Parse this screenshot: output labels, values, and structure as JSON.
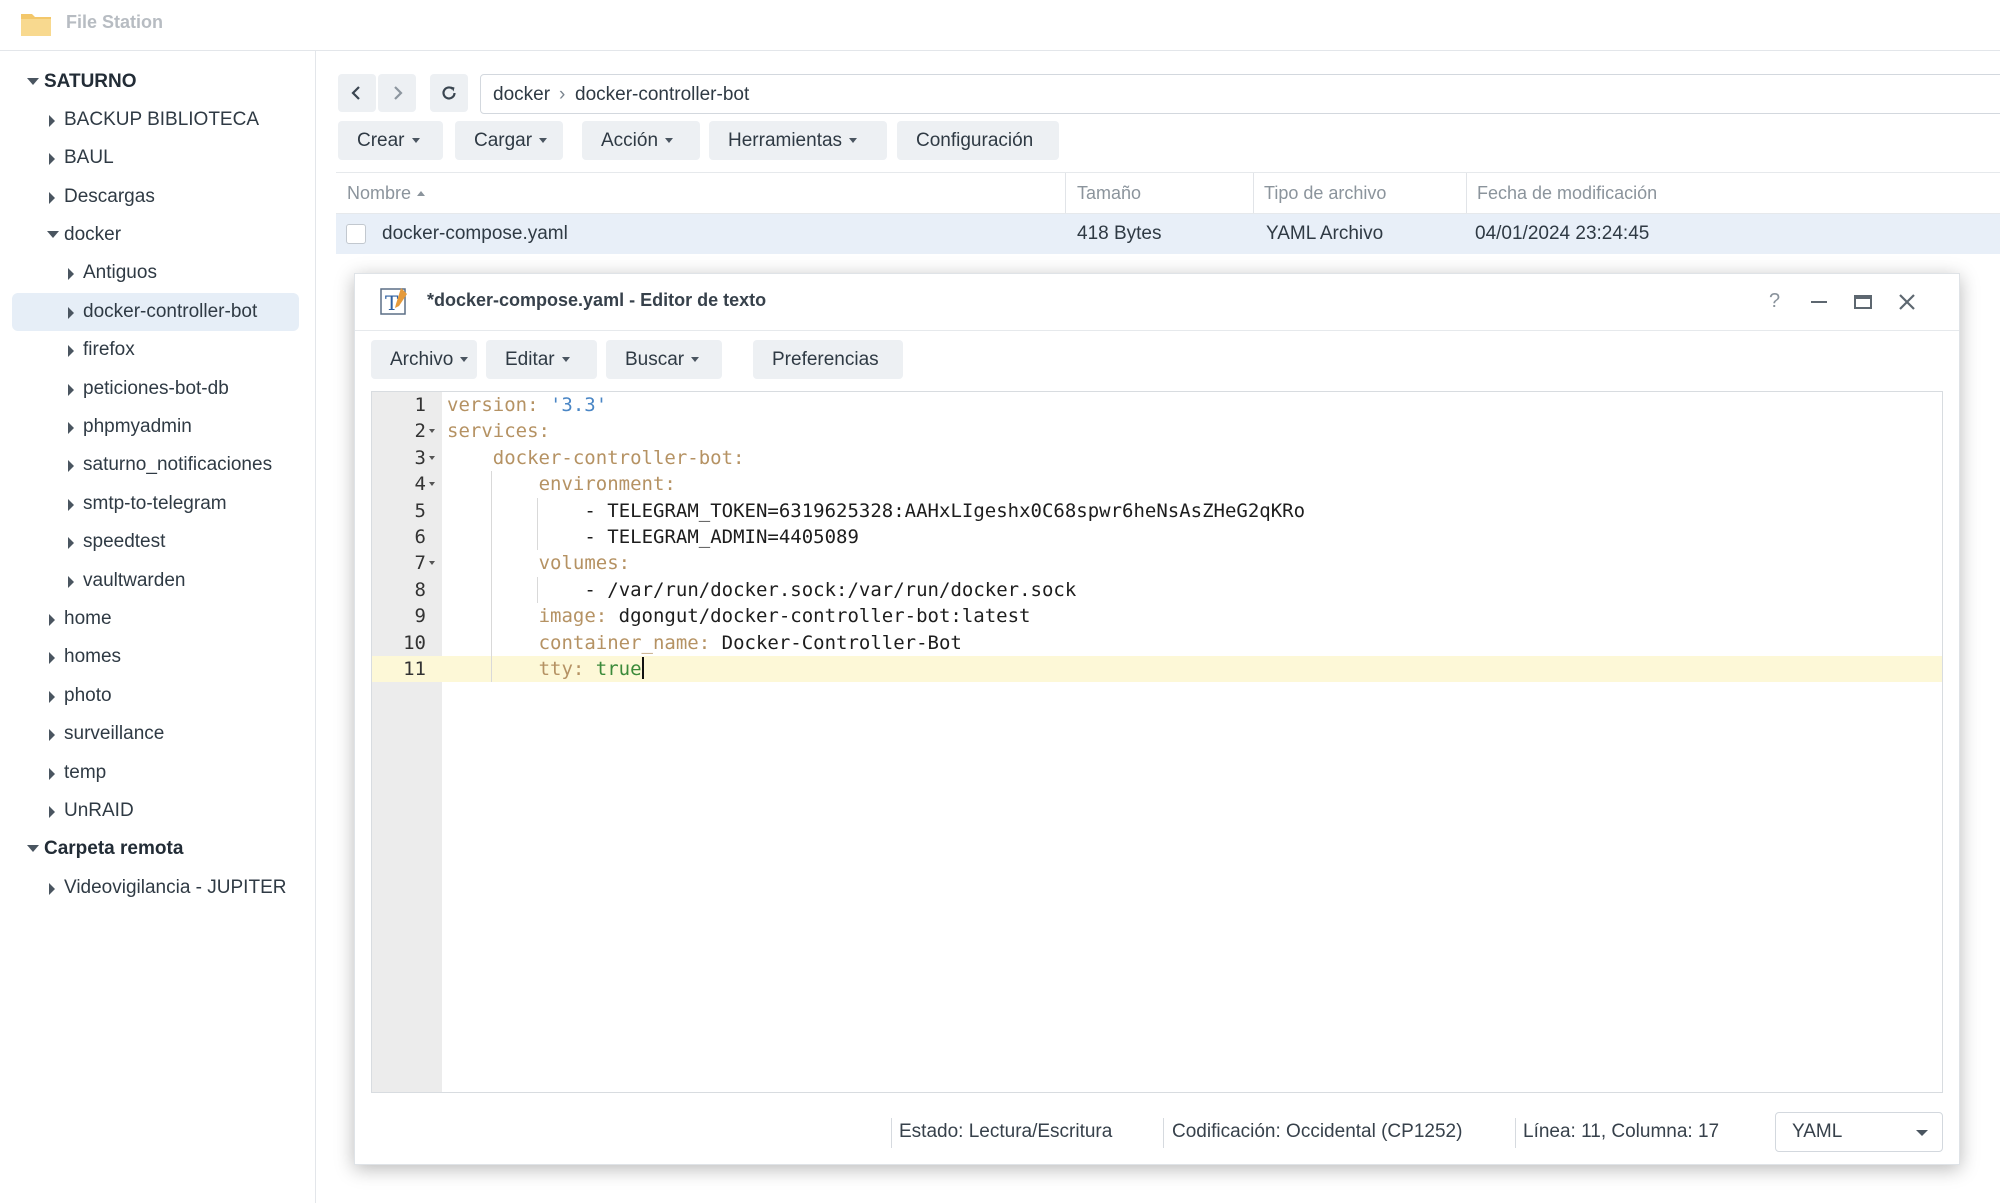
{
  "app": {
    "title": "File Station"
  },
  "sidebar": {
    "items": [
      {
        "label": "SATURNO",
        "level": 0,
        "expanded": true,
        "root": true
      },
      {
        "label": "BACKUP BIBLIOTECA",
        "level": 1
      },
      {
        "label": "BAUL",
        "level": 1
      },
      {
        "label": "Descargas",
        "level": 1
      },
      {
        "label": "docker",
        "level": 1,
        "expanded": true
      },
      {
        "label": "Antiguos",
        "level": 2
      },
      {
        "label": "docker-controller-bot",
        "level": 2,
        "selected": true
      },
      {
        "label": "firefox",
        "level": 2
      },
      {
        "label": "peticiones-bot-db",
        "level": 2
      },
      {
        "label": "phpmyadmin",
        "level": 2
      },
      {
        "label": "saturno_notificaciones",
        "level": 2
      },
      {
        "label": "smtp-to-telegram",
        "level": 2
      },
      {
        "label": "speedtest",
        "level": 2
      },
      {
        "label": "vaultwarden",
        "level": 2
      },
      {
        "label": "home",
        "level": 1
      },
      {
        "label": "homes",
        "level": 1
      },
      {
        "label": "photo",
        "level": 1
      },
      {
        "label": "surveillance",
        "level": 1
      },
      {
        "label": "temp",
        "level": 1
      },
      {
        "label": "UnRAID",
        "level": 1
      },
      {
        "label": "Carpeta remota",
        "level": 0,
        "expanded": true,
        "root": true
      },
      {
        "label": "Videovigilancia - JUPITER",
        "level": 1
      }
    ]
  },
  "path": {
    "segments": [
      "docker",
      "docker-controller-bot"
    ],
    "separator": "›"
  },
  "toolbar": {
    "buttons": [
      {
        "label": "Crear",
        "dropdown": true
      },
      {
        "label": "Cargar",
        "dropdown": true
      },
      {
        "label": "Acción",
        "dropdown": true
      },
      {
        "label": "Herramientas",
        "dropdown": true
      },
      {
        "label": "Configuración",
        "dropdown": false
      }
    ]
  },
  "file_list": {
    "columns": [
      "Nombre",
      "Tamaño",
      "Tipo de archivo",
      "Fecha de modificación"
    ],
    "rows": [
      {
        "name": "docker-compose.yaml",
        "size": "418 Bytes",
        "type": "YAML Archivo",
        "modified": "04/01/2024 23:24:45"
      }
    ]
  },
  "editor": {
    "title": "*docker-compose.yaml - Editor de texto",
    "controls": [
      "?",
      "minimize",
      "maximize",
      "close"
    ],
    "menu": [
      {
        "label": "Archivo",
        "dropdown": true
      },
      {
        "label": "Editar",
        "dropdown": true
      },
      {
        "label": "Buscar",
        "dropdown": true
      },
      {
        "label": "Preferencias",
        "dropdown": false
      }
    ],
    "active_line": 11,
    "lines": [
      {
        "n": "1",
        "indent": 0,
        "fold": false,
        "tokens": [
          [
            "k",
            "version: "
          ],
          [
            "s",
            "'3.3'"
          ]
        ]
      },
      {
        "n": "2",
        "indent": 0,
        "fold": true,
        "tokens": [
          [
            "k",
            "services:"
          ]
        ]
      },
      {
        "n": "3",
        "indent": 1,
        "fold": true,
        "tokens": [
          [
            "k",
            "docker-controller-bot:"
          ]
        ]
      },
      {
        "n": "4",
        "indent": 2,
        "fold": true,
        "tokens": [
          [
            "k",
            "environment:"
          ]
        ]
      },
      {
        "n": "5",
        "indent": 3,
        "fold": false,
        "tokens": [
          [
            "v",
            "- TELEGRAM_TOKEN=6319625328:AAHxLIgeshx0C68spwr6heNsAsZHeG2qKRo"
          ]
        ]
      },
      {
        "n": "6",
        "indent": 3,
        "fold": false,
        "tokens": [
          [
            "v",
            "- TELEGRAM_ADMIN=4405089"
          ]
        ]
      },
      {
        "n": "7",
        "indent": 2,
        "fold": true,
        "tokens": [
          [
            "k",
            "volumes:"
          ]
        ]
      },
      {
        "n": "8",
        "indent": 3,
        "fold": false,
        "tokens": [
          [
            "v",
            "- /var/run/docker.sock:/var/run/docker.sock"
          ]
        ]
      },
      {
        "n": "9",
        "indent": 2,
        "fold": false,
        "tokens": [
          [
            "k",
            "image: "
          ],
          [
            "v",
            "dgongut/docker-controller-bot:latest"
          ]
        ]
      },
      {
        "n": "10",
        "indent": 2,
        "fold": false,
        "tokens": [
          [
            "k",
            "container_name: "
          ],
          [
            "v",
            "Docker-Controller-Bot"
          ]
        ]
      },
      {
        "n": "11",
        "indent": 2,
        "fold": false,
        "tokens": [
          [
            "k",
            "tty: "
          ],
          [
            "b",
            "true"
          ]
        ]
      }
    ],
    "status": {
      "state": "Estado: Lectura/Escritura",
      "encoding": "Codificación: Occidental (CP1252)",
      "position": "Línea: 11, Columna: 17",
      "language": "YAML"
    }
  },
  "colors": {
    "selection": "#e8eff8",
    "active_line": "#fdf8d7",
    "yaml_key": "#b59263",
    "yaml_string": "#4a86c5",
    "yaml_bool": "#3b8a3a"
  }
}
